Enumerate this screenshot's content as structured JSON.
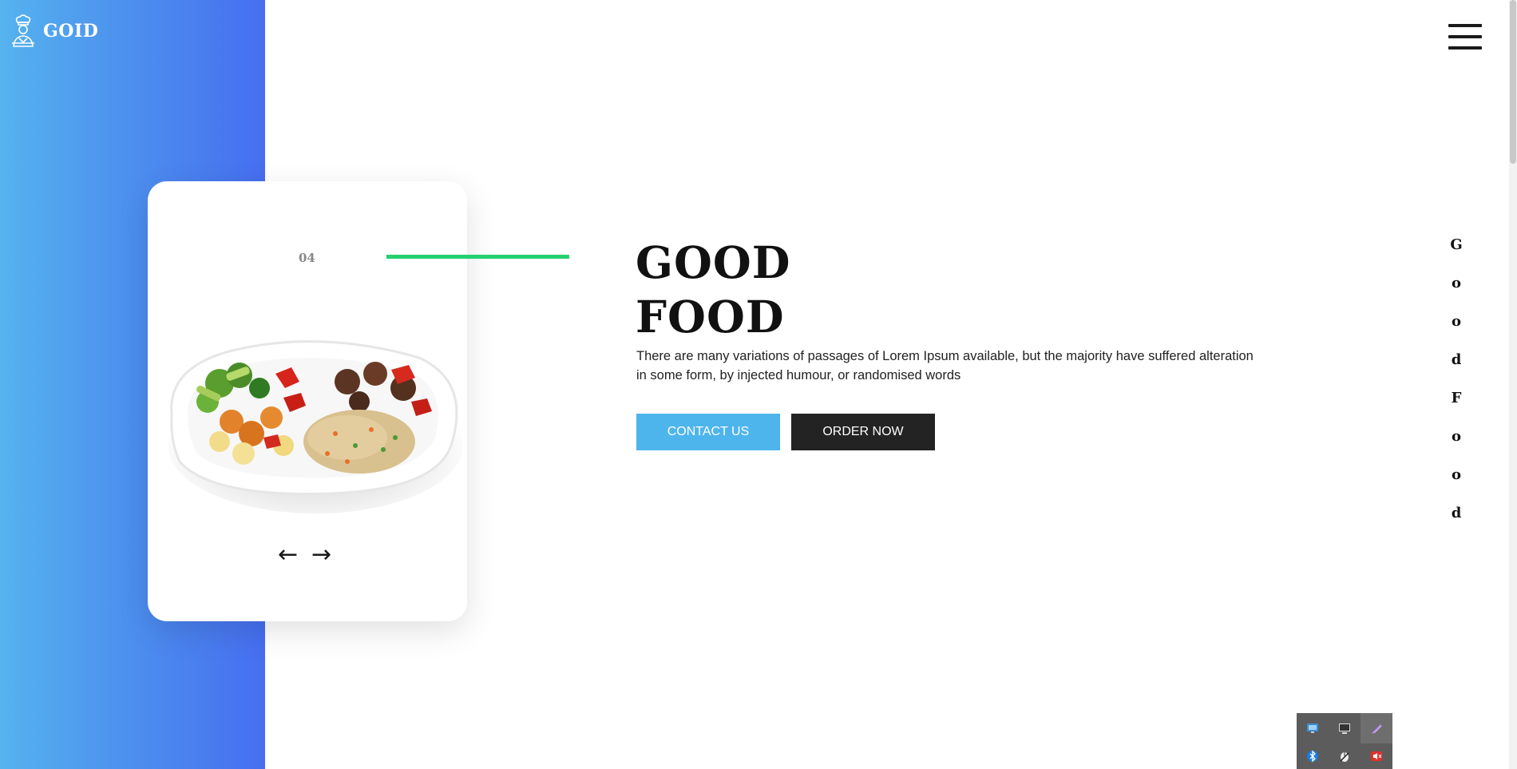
{
  "brand": {
    "name": "GOID",
    "icon": "chef-logo-icon"
  },
  "menu": {
    "icon": "hamburger-menu-icon"
  },
  "slider": {
    "slide_number": "04",
    "image": "food-plate-image",
    "prev_arrow": "←",
    "next_arrow": "→"
  },
  "hero": {
    "title_line1": "GOOD",
    "title_line2": "FOOD",
    "description": "There are many variations of passages of Lorem Ipsum available, but the majority have suffered alteration in some form, by injected humour, or randomised words",
    "contact_label": "CONTACT US",
    "order_label": "ORDER NOW"
  },
  "vertical_text": [
    "G",
    "o",
    "o",
    "d",
    "F",
    "o",
    "o",
    "d"
  ],
  "tray": {
    "icons": [
      "network-icon",
      "display-icon",
      "pen-icon",
      "bluetooth-icon",
      "mouse-icon",
      "volume-icon"
    ]
  },
  "colors": {
    "gradient_start": "#55b3ee",
    "gradient_end": "#466ef0",
    "accent_green": "#25d06e",
    "contact_button": "#4eb5ec",
    "order_button": "#232323"
  }
}
